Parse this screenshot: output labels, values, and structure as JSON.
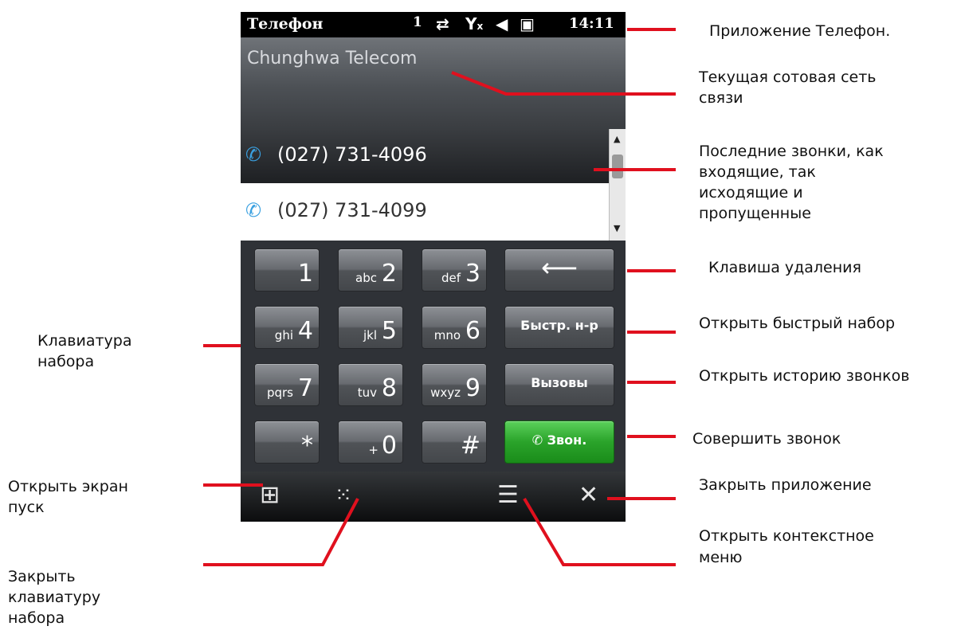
{
  "statusbar": {
    "title": "Телефон",
    "signal_level": "1",
    "icons": [
      "data-transfer-icon",
      "no-signal-icon",
      "speaker-muted-icon",
      "battery-charging-icon"
    ],
    "time": "14:11"
  },
  "carrier": {
    "name": "Chunghwa Telecom"
  },
  "recent_calls": [
    {
      "number": "(027) 731-4096",
      "icon": "outgoing-call-icon"
    },
    {
      "number": "(027) 731-4099",
      "icon": "incoming-call-icon"
    }
  ],
  "keypad": {
    "keys": [
      {
        "main": "1",
        "sub": ""
      },
      {
        "main": "2",
        "sub": "abc"
      },
      {
        "main": "3",
        "sub": "def"
      },
      {
        "main": "4",
        "sub": "ghi"
      },
      {
        "main": "5",
        "sub": "jkl"
      },
      {
        "main": "6",
        "sub": "mno"
      },
      {
        "main": "7",
        "sub": "pqrs"
      },
      {
        "main": "8",
        "sub": "tuv"
      },
      {
        "main": "9",
        "sub": "wxyz"
      },
      {
        "main": "*",
        "sub": ""
      },
      {
        "main": "0",
        "sub": "+"
      },
      {
        "main": "#",
        "sub": ""
      }
    ],
    "backspace": "⟵",
    "speed_dial": "Быстр. н-р",
    "calls": "Вызовы",
    "dial": "Звон."
  },
  "bottombar": {
    "start": "windows-logo-icon",
    "hide_keypad": "hide-keypad-icon",
    "menu": "menu-icon",
    "close": "close-icon"
  },
  "annotations": {
    "app": "Приложение Телефон.",
    "network_1": "Текущая сотовая сеть",
    "network_2": "связи",
    "recent_1": "Последние звонки, как",
    "recent_2": "входящие, так",
    "recent_3": "исходящие и",
    "recent_4": "пропущенные",
    "delete_key": "Клавиша удаления",
    "speed_dial": "Открыть быстрый набор",
    "history": "Открыть историю звонков",
    "make_call": "Совершить звонок",
    "close_app": "Закрыть приложение",
    "context_1": "Открыть контекстное",
    "context_2": "меню",
    "keypad_1": "Клавиатура",
    "keypad_2": "набора",
    "start_1": "Открыть экран",
    "start_2": "пуск",
    "hide_1": "Закрыть",
    "hide_2": "клавиатуру",
    "hide_3": "набора"
  },
  "colors": {
    "annotation_line": "#e0101e",
    "call_key": "#2aa32a"
  }
}
